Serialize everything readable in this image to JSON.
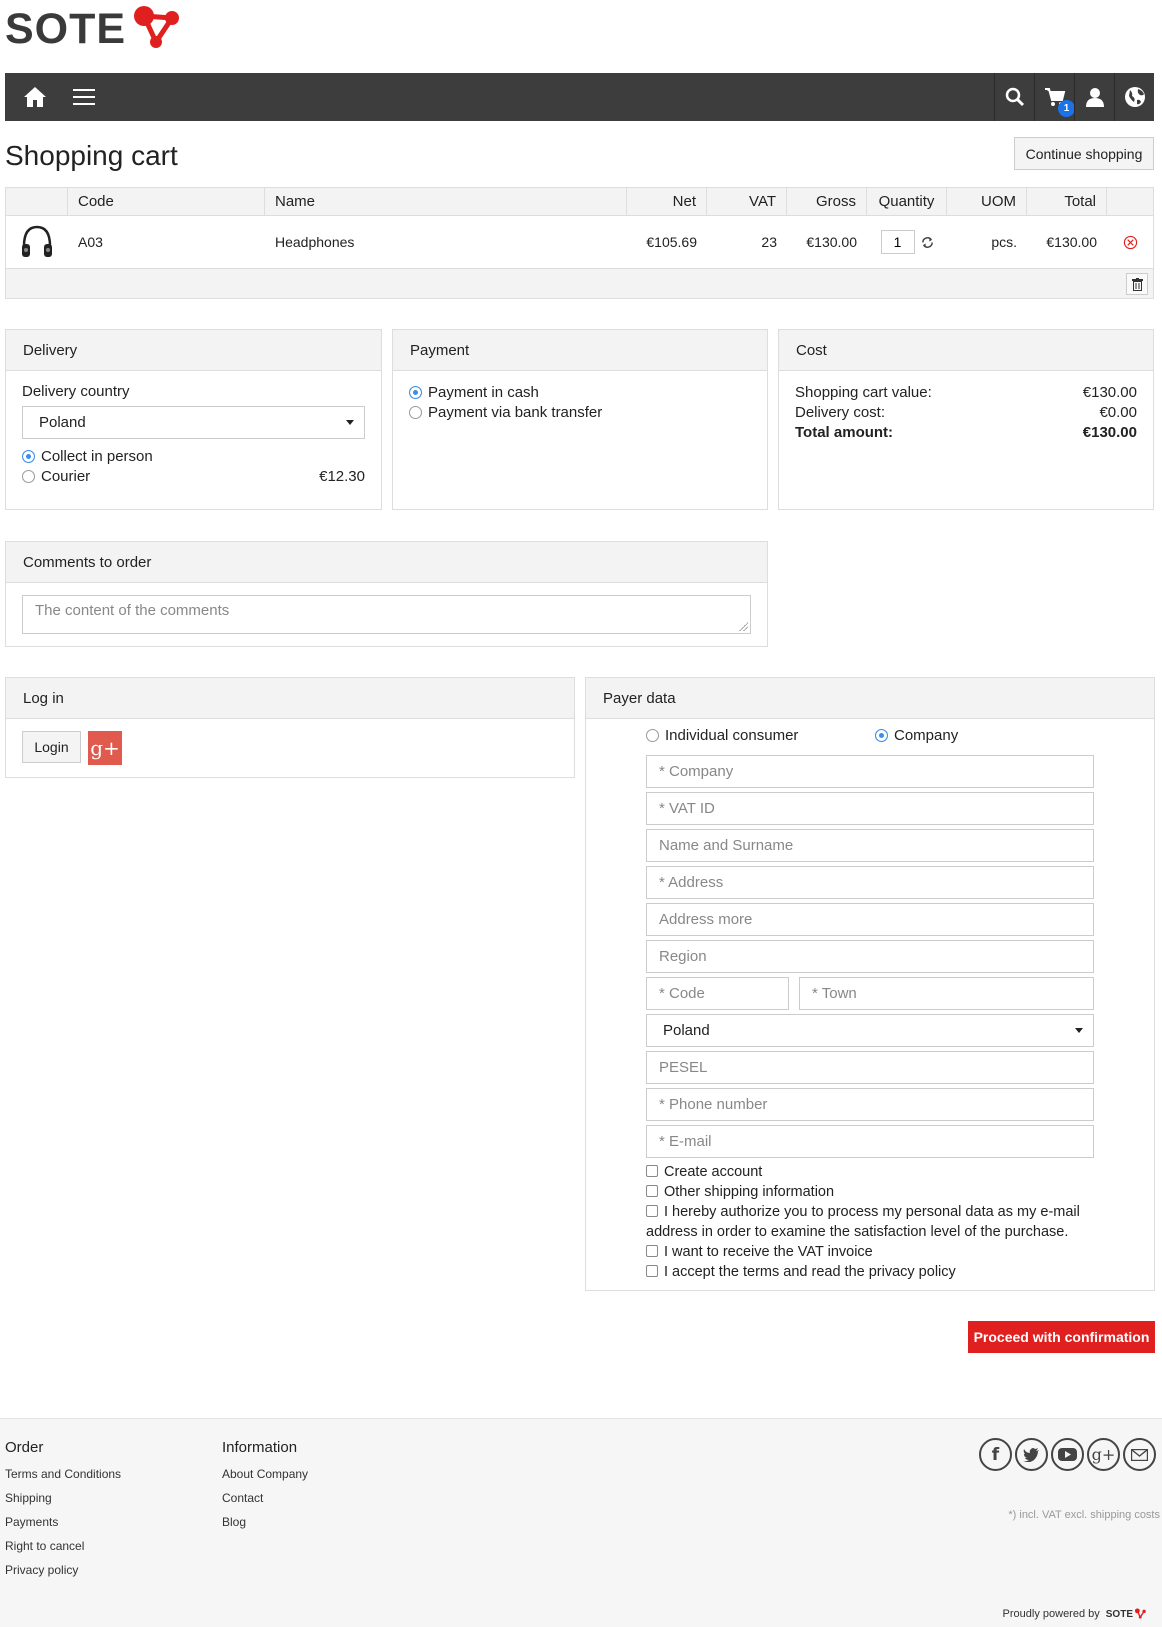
{
  "brand": {
    "name": "SOTE",
    "accent": "#e0201f"
  },
  "navbar": {
    "cart_count": "1",
    "icons": [
      "home-icon",
      "menu-icon",
      "search-icon",
      "cart-icon",
      "user-icon",
      "globe-icon"
    ]
  },
  "page": {
    "title": "Shopping cart",
    "continue_label": "Continue shopping"
  },
  "cart": {
    "headers": {
      "code": "Code",
      "name": "Name",
      "net": "Net",
      "vat": "VAT",
      "gross": "Gross",
      "quantity": "Quantity",
      "uom": "UOM",
      "total": "Total"
    },
    "rows": [
      {
        "image": "headphones-icon",
        "code": "A03",
        "name": "Headphones",
        "net": "€105.69",
        "vat": "23",
        "gross": "€130.00",
        "quantity": "1",
        "uom": "pcs.",
        "total": "€130.00"
      }
    ]
  },
  "delivery": {
    "title": "Delivery",
    "country_label": "Delivery country",
    "country": "Poland",
    "options": [
      {
        "label": "Collect in person",
        "price": "",
        "selected": true
      },
      {
        "label": "Courier",
        "price": "€12.30",
        "selected": false
      }
    ]
  },
  "payment": {
    "title": "Payment",
    "options": [
      {
        "label": "Payment in cash",
        "selected": true
      },
      {
        "label": "Payment via bank transfer",
        "selected": false
      }
    ]
  },
  "cost": {
    "title": "Cost",
    "cart_value_label": "Shopping cart value:",
    "cart_value": "€130.00",
    "delivery_label": "Delivery cost:",
    "delivery": "€0.00",
    "total_label": "Total amount:",
    "total": "€130.00"
  },
  "comments": {
    "title": "Comments to order",
    "placeholder": "The content of the comments"
  },
  "login": {
    "title": "Log in",
    "login_label": "Login",
    "gplus_label": "g+"
  },
  "payer": {
    "title": "Payer data",
    "type_individual": "Individual consumer",
    "type_company": "Company",
    "selected_type": "Company",
    "fields": {
      "company": "* Company",
      "vat_id": "* VAT ID",
      "name": "Name and Surname",
      "address": "* Address",
      "address_more": "Address more",
      "region": "Region",
      "code": "* Code",
      "town": "* Town",
      "country": "Poland",
      "pesel": "PESEL",
      "phone": "* Phone number",
      "email": "* E-mail"
    },
    "checkboxes": {
      "create_account": "Create account",
      "other_shipping": "Other shipping information",
      "authorize_line1": "I hereby authorize you to process my personal data as my e-mail",
      "authorize_line2": "address in order to examine the satisfaction level of the purchase.",
      "vat_invoice": "I want to receive the VAT invoice",
      "terms": "I accept the terms and read the privacy policy"
    }
  },
  "proceed_label": "Proceed with confirmation",
  "footer": {
    "order_title": "Order",
    "order_links": [
      "Terms and Conditions",
      "Shipping",
      "Payments",
      "Right to cancel",
      "Privacy policy"
    ],
    "info_title": "Information",
    "info_links": [
      "About Company",
      "Contact",
      "Blog"
    ],
    "social": [
      "facebook-icon",
      "twitter-icon",
      "youtube-icon",
      "google-plus-icon",
      "mail-icon"
    ],
    "vat_note": "*) incl. VAT excl. shipping costs",
    "powered_by": "Proudly powered by",
    "powered_brand": "SOTE"
  }
}
